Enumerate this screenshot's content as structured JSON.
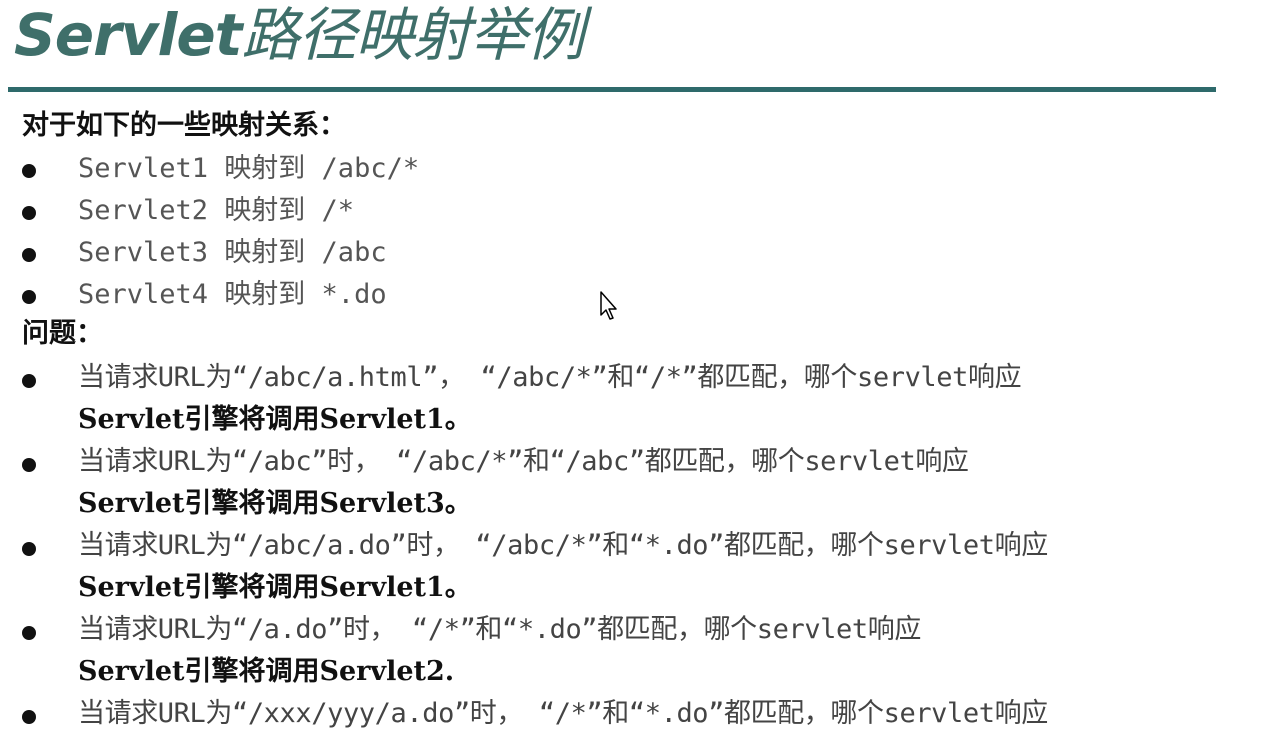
{
  "slide": {
    "title_latin": "Servlet",
    "title_cjk": "路径映射举例",
    "intro_heading": "对于如下的一些映射关系：",
    "mappings": [
      "Servlet1 映射到 /abc/*",
      "Servlet2 映射到 /*",
      "Servlet3 映射到 /abc",
      "Servlet4 映射到 *.do"
    ],
    "questions_heading": "问题：",
    "questions": [
      {
        "question": "当请求URL为“/abc/a.html”， “/abc/*”和“/*”都匹配，哪个servlet响应",
        "answer": "Servlet引擎将调用Servlet1。"
      },
      {
        "question": "当请求URL为“/abc”时， “/abc/*”和“/abc”都匹配，哪个servlet响应",
        "answer": "Servlet引擎将调用Servlet3。"
      },
      {
        "question": "当请求URL为“/abc/a.do”时， “/abc/*”和“*.do”都匹配，哪个servlet响应",
        "answer": "Servlet引擎将调用Servlet1。"
      },
      {
        "question": "当请求URL为“/a.do”时， “/*”和“*.do”都匹配，哪个servlet响应",
        "answer": "Servlet引擎将调用Servlet2."
      },
      {
        "question": "当请求URL为“/xxx/yyy/a.do”时， “/*”和“*.do”都匹配，哪个servlet响应",
        "answer": ""
      }
    ],
    "icons": {
      "cursor": "mouse-pointer-icon"
    },
    "colors": {
      "title": "#3f6f6a",
      "rule": "#2e6a6b",
      "body_text": "#555555",
      "answer_text": "#111111"
    }
  }
}
